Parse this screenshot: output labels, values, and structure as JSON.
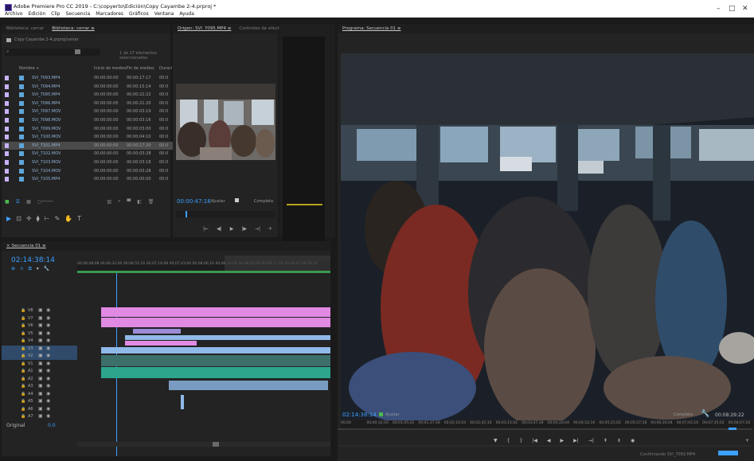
{
  "window": {
    "title": "Adobe Premiere Pro CC 2019 - C:\\copyerto\\Edición\\Copy Cayambe 2-4.prproj *",
    "menu": [
      "Archivo",
      "Edición",
      "Clip",
      "Secuencia",
      "Marcadores",
      "Gráficos",
      "Ventana",
      "Ayuda"
    ],
    "controls": [
      "–",
      "□",
      "✕"
    ]
  },
  "project_panel": {
    "tabs": [
      "Biblioteca: cerrar",
      "Biblioteca: cerrar ≡"
    ],
    "project_name": "Copy Cayambe 2-4.prproj/cerrar",
    "search_placeholder": "",
    "item_count": "1 de 17 elementos seleccionados",
    "headers": {
      "name": "Nombre ∧",
      "start": "Inicio de medios",
      "end": "Fin de medios",
      "dur": "Duraci"
    },
    "items": [
      {
        "name": "SVI_7093.MP4",
        "start": "00:00:00:00",
        "end": "00:00:17:17",
        "dur": "00:0"
      },
      {
        "name": "SVI_7094.MP4",
        "start": "00:00:00:00",
        "end": "00:00:15:14",
        "dur": "00:0"
      },
      {
        "name": "SVI_7095.MP4",
        "start": "00:00:00:00",
        "end": "00:00:22:22",
        "dur": "00:0"
      },
      {
        "name": "SVI_7096.MP4",
        "start": "00:00:00:00",
        "end": "00:00:21:20",
        "dur": "00:0"
      },
      {
        "name": "SVI_7097.MOV",
        "start": "00:00:00:00",
        "end": "00:00:03:19",
        "dur": "00:0"
      },
      {
        "name": "SVI_7098.MOV",
        "start": "00:00:00:00",
        "end": "00:00:03:16",
        "dur": "00:0"
      },
      {
        "name": "SVI_7099.MOV",
        "start": "00:00:00:00",
        "end": "00:00:03:00",
        "dur": "00:0"
      },
      {
        "name": "SVI_7100.MOV",
        "start": "00:00:00:00",
        "end": "00:00:04:10",
        "dur": "00:0"
      },
      {
        "name": "SVI_7101.MP4",
        "start": "00:00:00:00",
        "end": "00:00:17:20",
        "dur": "00:0"
      },
      {
        "name": "SVI_7102.MOV",
        "start": "00:00:00:00",
        "end": "00:00:03:28",
        "dur": "00:0"
      },
      {
        "name": "SVI_7103.MOV",
        "start": "00:00:00:00",
        "end": "00:00:03:18",
        "dur": "00:0"
      },
      {
        "name": "SVI_7104.MOV",
        "start": "00:00:00:00",
        "end": "00:00:03:28",
        "dur": "00:0"
      },
      {
        "name": "SVI_7105.MP4",
        "start": "00:00:00:00",
        "end": "00:00:00:00",
        "dur": "00:0"
      }
    ]
  },
  "source_monitor": {
    "tabs": [
      "Origen: SVI_7095.MP4 ≡",
      "Controles de efectos"
    ],
    "timecode": "00:00:47:18",
    "fit": "Ajustar",
    "quality": "Completa"
  },
  "program_monitor": {
    "tab": "Programa: Secuencia 01 ≡",
    "timecode": "02:14:38:14",
    "fit": "Ajustar",
    "quality": "Completa",
    "duration": "00:08:29:22",
    "tooltip": "Confirmando SVI_7093.MP4",
    "ruler": [
      "00;00",
      "00;00;32;16",
      "00;01;05;02",
      "00;01;37;18",
      "00;02;10;04",
      "00;02;42;16",
      "00;03;15;02",
      "00;03;47;18",
      "00;04;20;04",
      "00;04;52;16",
      "00;05;25;02",
      "00;05;57;18",
      "00;06;30;04",
      "00;07;02;16",
      "00;07;35;02",
      "00;08;07;18"
    ]
  },
  "timeline": {
    "tab": "× Secuencia 01 ≡",
    "timecode": "02:14:38:14",
    "ruler": [
      "00;06;08;08",
      "00;06;32;00",
      "00;06;55;16",
      "00;07;19;08",
      "00;07;43;00",
      "00;08;06;16",
      "00;08;30;08",
      "00;08;54;00",
      "00;09;17;16",
      "00;09;41;08",
      "00;10"
    ],
    "tracks": [
      "V8",
      "V7",
      "V6",
      "V5",
      "V4",
      "V3",
      "V2",
      "V1",
      "A1",
      "A2",
      "A3",
      "A4",
      "A5",
      "A6",
      "A7"
    ],
    "master_label": "Original",
    "master_value": "0.0"
  },
  "colors": {
    "accent": "#3ca0ff",
    "clip_pink": "#e08ae3",
    "clip_blue": "#8fb9e8",
    "clip_green": "#2ca58d",
    "clip_purple": "#9c8bd6"
  }
}
